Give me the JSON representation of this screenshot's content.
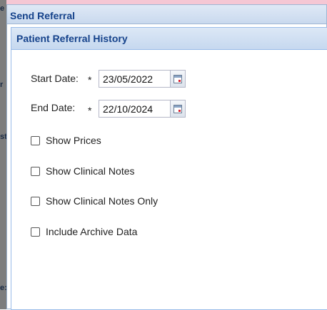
{
  "window": {
    "title": "Send Referral"
  },
  "panel": {
    "title": "Patient Referral History"
  },
  "form": {
    "start_date": {
      "label": "Start Date:",
      "required_mark": "*",
      "value": "23/05/2022"
    },
    "end_date": {
      "label": "End Date:",
      "required_mark": "*",
      "value": "22/10/2024"
    },
    "checkboxes": [
      {
        "label": "Show Prices",
        "checked": false
      },
      {
        "label": "Show Clinical Notes",
        "checked": false
      },
      {
        "label": "Show Clinical Notes Only",
        "checked": false
      },
      {
        "label": "Include Archive Data",
        "checked": false
      }
    ]
  },
  "background_fragments": [
    "e",
    "r",
    "st",
    "e:"
  ],
  "colors": {
    "title_text": "#15428b",
    "header_bg": "#c9d9ee",
    "border": "#99bbe8"
  }
}
